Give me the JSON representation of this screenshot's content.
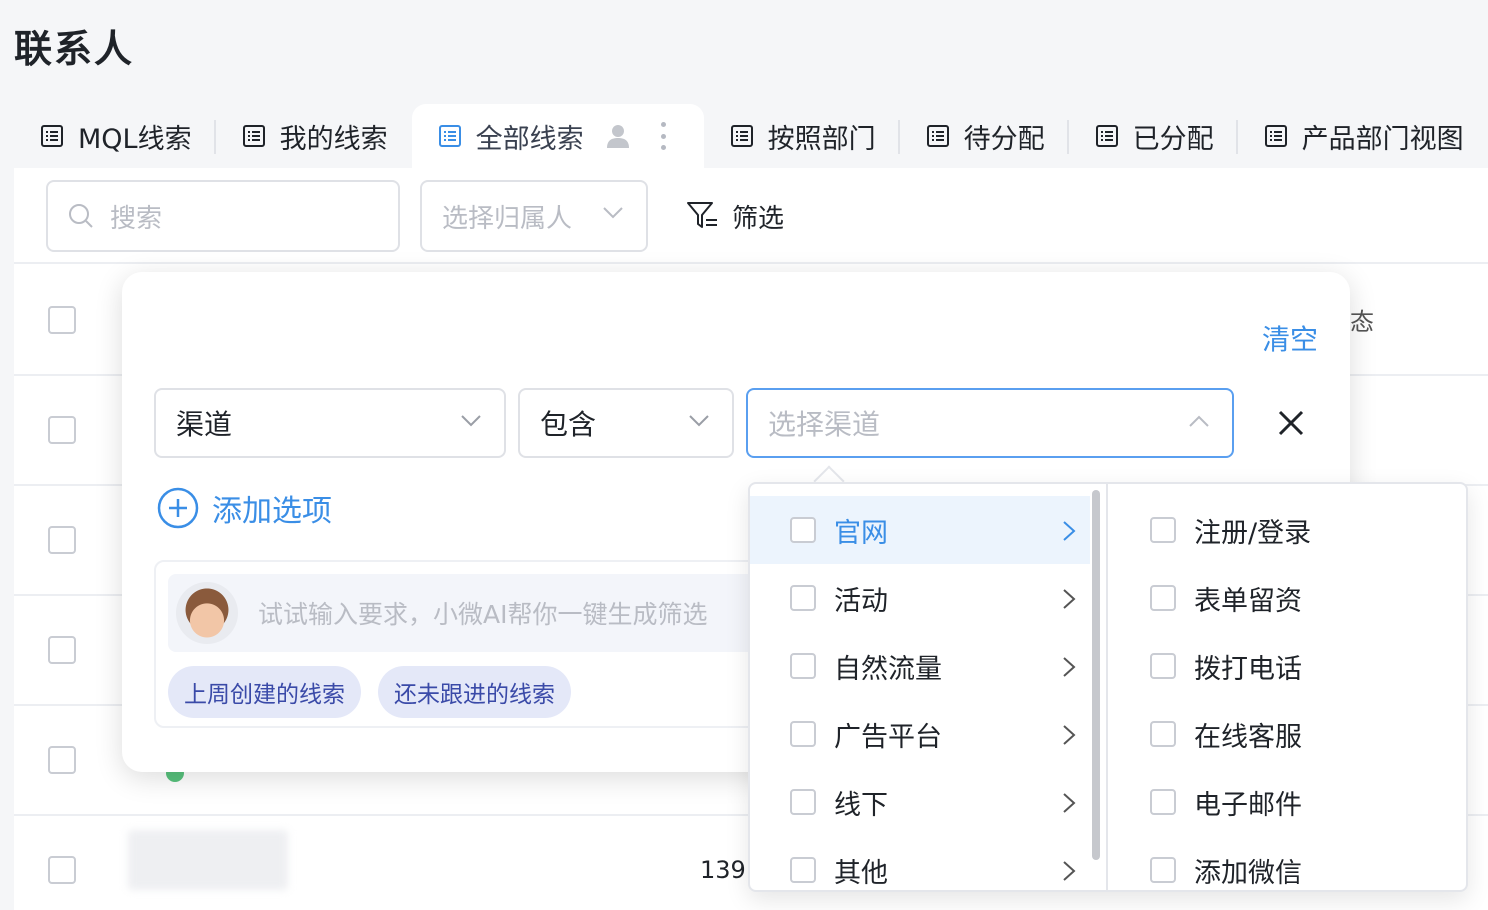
{
  "page": {
    "title": "联系人"
  },
  "tabs": [
    {
      "label": "MQL线索"
    },
    {
      "label": "我的线索"
    },
    {
      "label": "全部线索",
      "active": true
    },
    {
      "label": "按照部门"
    },
    {
      "label": "待分配"
    },
    {
      "label": "已分配"
    },
    {
      "label": "产品部门视图"
    }
  ],
  "toolbar": {
    "search_placeholder": "搜索",
    "owner_placeholder": "选择归属人",
    "filter_label": "筛选"
  },
  "table": {
    "partial_header": "态",
    "partial_phone": "139"
  },
  "filter": {
    "clear_label": "清空",
    "field_value": "渠道",
    "operator_value": "包含",
    "channel_placeholder": "选择渠道",
    "add_option_label": "添加选项",
    "ai_placeholder": "试试输入要求，小微AI帮你一键生成筛选",
    "chips": [
      "上周创建的线索",
      "还未跟进的线索"
    ]
  },
  "cascader": {
    "level1": [
      "官网",
      "活动",
      "自然流量",
      "广告平台",
      "线下",
      "其他"
    ],
    "level1_active_index": 0,
    "level2": [
      "注册/登录",
      "表单留资",
      "拨打电话",
      "在线客服",
      "电子邮件",
      "添加微信"
    ]
  },
  "colors": {
    "accent": "#3a8ee6",
    "active_bg": "#ecf4fd",
    "chip_bg": "#e4e8f8"
  }
}
